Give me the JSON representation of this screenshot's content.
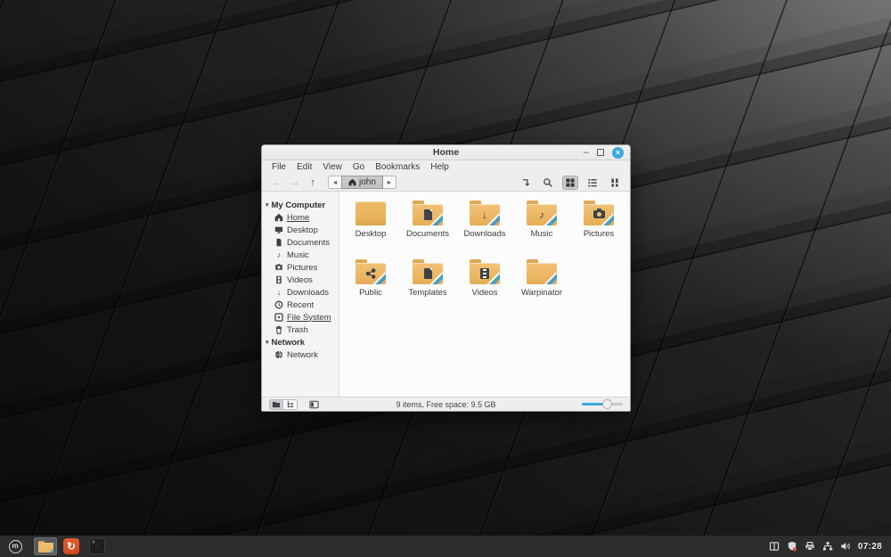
{
  "window": {
    "title": "Home"
  },
  "menubar": {
    "items": [
      "File",
      "Edit",
      "View",
      "Go",
      "Bookmarks",
      "Help"
    ]
  },
  "toolbar": {
    "breadcrumb": "john"
  },
  "sidebar": {
    "sections": [
      {
        "label": "My Computer",
        "items": [
          {
            "label": "Home"
          },
          {
            "label": "Desktop"
          },
          {
            "label": "Documents"
          },
          {
            "label": "Music"
          },
          {
            "label": "Pictures"
          },
          {
            "label": "Videos"
          },
          {
            "label": "Downloads"
          },
          {
            "label": "Recent"
          },
          {
            "label": "File System"
          },
          {
            "label": "Trash"
          }
        ]
      },
      {
        "label": "Network",
        "items": [
          {
            "label": "Network"
          }
        ]
      }
    ]
  },
  "main": {
    "folders": [
      {
        "name": "Desktop"
      },
      {
        "name": "Documents"
      },
      {
        "name": "Downloads"
      },
      {
        "name": "Music"
      },
      {
        "name": "Pictures"
      },
      {
        "name": "Public"
      },
      {
        "name": "Templates"
      },
      {
        "name": "Videos"
      },
      {
        "name": "Warpinator"
      }
    ]
  },
  "statusbar": {
    "text": "9 items, Free space: 9.5 GB"
  },
  "taskbar": {
    "clock": "07:28"
  },
  "icons": {
    "back": "←",
    "forward": "→",
    "up": "↑",
    "crumb_left": "◂",
    "crumb_right": "▸",
    "minimize": "–",
    "close_x": "×",
    "section_collapse": "▾",
    "download_arrow": "↓",
    "music_note": "♪",
    "refresh_logo": "↻",
    "terminal_prompt": ">_",
    "mint_letter": "m"
  },
  "colors": {
    "accent_blue": "#3ba9e0",
    "folder_orange": "#ecb765",
    "folder_stripe_teal": "#47a0c4",
    "taskbar_dark": "#2c2c2c",
    "app_orange": "#d2491c"
  }
}
